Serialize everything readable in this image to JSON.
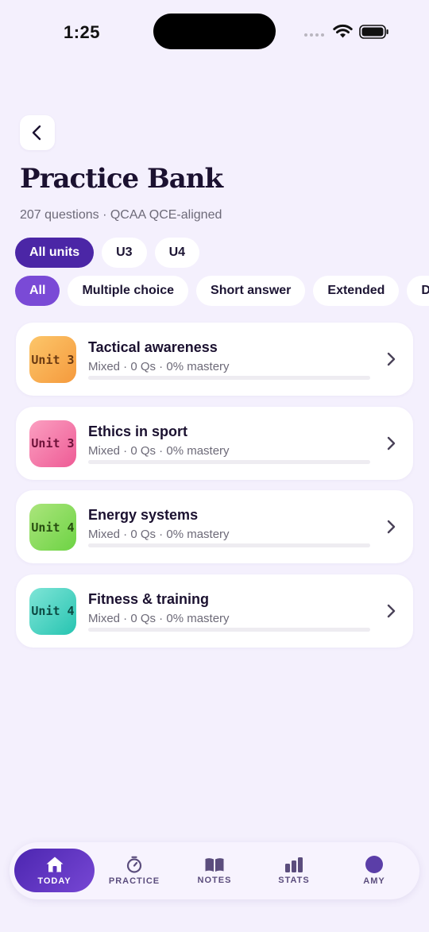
{
  "status_bar": {
    "time": "1:25"
  },
  "header": {
    "title": "Practice Bank",
    "subtitle": "207 questions · QCAA QCE-aligned"
  },
  "unit_filters": [
    {
      "label": "All units",
      "active": true
    },
    {
      "label": "U3",
      "active": false
    },
    {
      "label": "U4",
      "active": false
    }
  ],
  "type_filters": [
    {
      "label": "All",
      "active": true
    },
    {
      "label": "Multiple choice",
      "active": false
    },
    {
      "label": "Short answer",
      "active": false
    },
    {
      "label": "Extended",
      "active": false
    },
    {
      "label": "D",
      "active": false
    }
  ],
  "topics": [
    {
      "unit_badge": "Unit 3",
      "title": "Tactical awareness",
      "meta": "Mixed · 0 Qs · 0% mastery",
      "mastery": 0,
      "badge_colors": [
        "#fcc66a",
        "#f59a3d"
      ],
      "badge_text_color": "#6b3a12"
    },
    {
      "unit_badge": "Unit 3",
      "title": "Ethics in sport",
      "meta": "Mixed · 0 Qs · 0% mastery",
      "mastery": 0,
      "badge_colors": [
        "#fb9fc1",
        "#ee5b95"
      ],
      "badge_text_color": "#6e1239"
    },
    {
      "unit_badge": "Unit 4",
      "title": "Energy systems",
      "meta": "Mixed · 0 Qs · 0% mastery",
      "mastery": 0,
      "badge_colors": [
        "#abe57c",
        "#6dd344"
      ],
      "badge_text_color": "#274d10"
    },
    {
      "unit_badge": "Unit 4",
      "title": "Fitness & training",
      "meta": "Mixed · 0 Qs · 0% mastery",
      "mastery": 0,
      "badge_colors": [
        "#7fe5d7",
        "#27c4b1"
      ],
      "badge_text_color": "#0c4a43"
    }
  ],
  "tab_bar": {
    "today": "TODAY",
    "practice": "PRACTICE",
    "notes": "NOTES",
    "stats": "STATS",
    "amy": "AMY"
  },
  "colors": {
    "accent_dark": "#4b26a6",
    "accent": "#7a4ad6",
    "background": "#f4f0fd"
  }
}
